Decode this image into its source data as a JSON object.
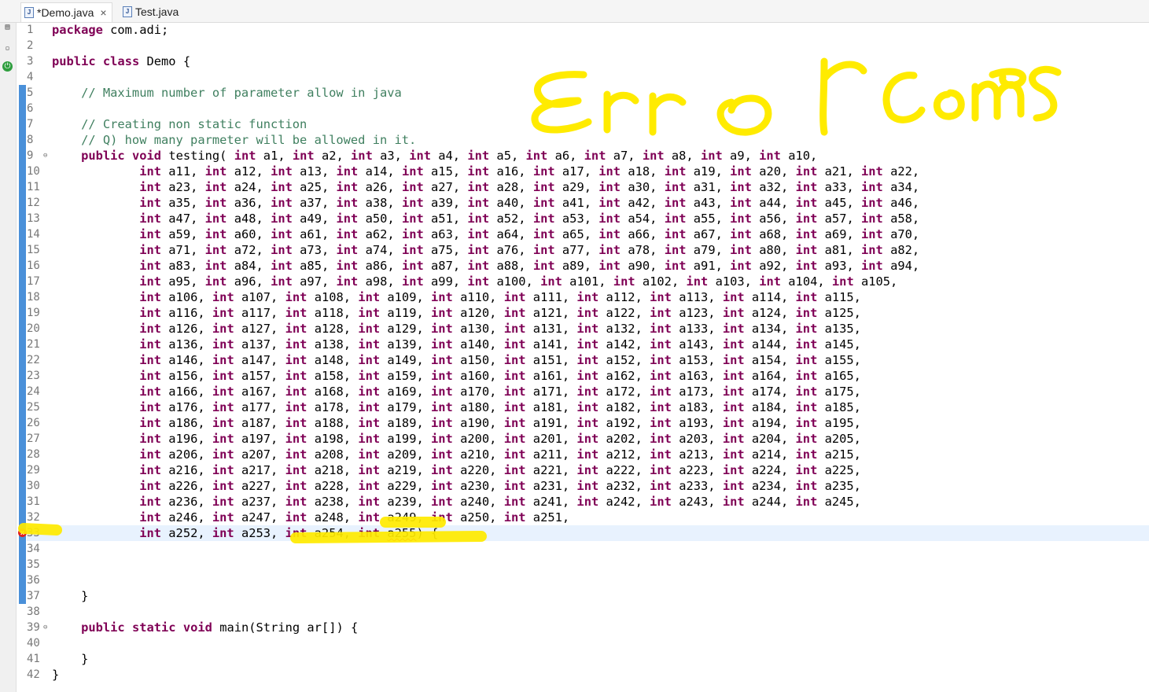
{
  "tabs": [
    {
      "label": "*Demo.java",
      "close": "×",
      "active": true
    },
    {
      "label": "Test.java",
      "active": false
    }
  ],
  "lines": [
    {
      "n": "1",
      "code": [
        {
          "t": "package",
          "c": "kw"
        },
        {
          "t": " com.adi;"
        }
      ]
    },
    {
      "n": "2",
      "code": []
    },
    {
      "n": "3",
      "code": [
        {
          "t": "public",
          "c": "kw"
        },
        {
          "t": " "
        },
        {
          "t": "class",
          "c": "kw"
        },
        {
          "t": " Demo {"
        }
      ]
    },
    {
      "n": "4",
      "code": []
    },
    {
      "n": "5",
      "code": [
        {
          "t": "    // Maximum number of parameter allow in java",
          "c": "cm"
        }
      ]
    },
    {
      "n": "6",
      "code": []
    },
    {
      "n": "7",
      "code": [
        {
          "t": "    // Creating non static function",
          "c": "cm"
        }
      ]
    },
    {
      "n": "8",
      "code": [
        {
          "t": "    // Q) how many parmeter will be allowed in it.",
          "c": "cm"
        }
      ]
    },
    {
      "n": "9",
      "fold": true,
      "code": [
        {
          "t": "    "
        },
        {
          "t": "public",
          "c": "kw"
        },
        {
          "t": " "
        },
        {
          "t": "void",
          "c": "kw"
        },
        {
          "t": " testing( "
        },
        {
          "t": "int",
          "c": "kw"
        },
        {
          "t": " a1, "
        },
        {
          "t": "int",
          "c": "kw"
        },
        {
          "t": " a2, "
        },
        {
          "t": "int",
          "c": "kw"
        },
        {
          "t": " a3, "
        },
        {
          "t": "int",
          "c": "kw"
        },
        {
          "t": " a4, "
        },
        {
          "t": "int",
          "c": "kw"
        },
        {
          "t": " a5, "
        },
        {
          "t": "int",
          "c": "kw"
        },
        {
          "t": " a6, "
        },
        {
          "t": "int",
          "c": "kw"
        },
        {
          "t": " a7, "
        },
        {
          "t": "int",
          "c": "kw"
        },
        {
          "t": " a8, "
        },
        {
          "t": "int",
          "c": "kw"
        },
        {
          "t": " a9, "
        },
        {
          "t": "int",
          "c": "kw"
        },
        {
          "t": " a10,"
        }
      ]
    },
    {
      "n": "10",
      "params": [
        11,
        22
      ]
    },
    {
      "n": "11",
      "params": [
        23,
        34
      ]
    },
    {
      "n": "12",
      "params": [
        35,
        46
      ]
    },
    {
      "n": "13",
      "params": [
        47,
        58
      ]
    },
    {
      "n": "14",
      "params": [
        59,
        70
      ]
    },
    {
      "n": "15",
      "params": [
        71,
        82
      ]
    },
    {
      "n": "16",
      "params": [
        83,
        94
      ]
    },
    {
      "n": "17",
      "params": [
        95,
        105
      ]
    },
    {
      "n": "18",
      "params": [
        106,
        115
      ]
    },
    {
      "n": "19",
      "params": [
        116,
        125
      ]
    },
    {
      "n": "20",
      "params": [
        126,
        135
      ]
    },
    {
      "n": "21",
      "params": [
        136,
        145
      ]
    },
    {
      "n": "22",
      "params": [
        146,
        155
      ]
    },
    {
      "n": "23",
      "params": [
        156,
        165
      ]
    },
    {
      "n": "24",
      "params": [
        166,
        175
      ]
    },
    {
      "n": "25",
      "params": [
        176,
        185
      ]
    },
    {
      "n": "26",
      "params": [
        186,
        195
      ]
    },
    {
      "n": "27",
      "params": [
        196,
        205
      ]
    },
    {
      "n": "28",
      "params": [
        206,
        215
      ]
    },
    {
      "n": "29",
      "params": [
        216,
        225
      ]
    },
    {
      "n": "30",
      "params": [
        226,
        235
      ]
    },
    {
      "n": "31",
      "params": [
        236,
        245
      ]
    },
    {
      "n": "32",
      "params": [
        246,
        251
      ]
    },
    {
      "n": "33",
      "error": true,
      "code": [
        {
          "t": "            "
        },
        {
          "t": "int",
          "c": "kw"
        },
        {
          "t": " a252, "
        },
        {
          "t": "int",
          "c": "kw"
        },
        {
          "t": " a253, "
        },
        {
          "t": "int",
          "c": "kw"
        },
        {
          "t": " a254, "
        },
        {
          "t": "int",
          "c": "kw"
        },
        {
          "t": " "
        },
        {
          "t": "a255",
          "c": "err"
        },
        {
          "t": ") {"
        }
      ]
    },
    {
      "n": "34",
      "code": []
    },
    {
      "n": "35",
      "code": []
    },
    {
      "n": "36",
      "code": []
    },
    {
      "n": "37",
      "code": [
        {
          "t": "    }"
        }
      ]
    },
    {
      "n": "38",
      "code": []
    },
    {
      "n": "39",
      "fold": true,
      "code": [
        {
          "t": "    "
        },
        {
          "t": "public",
          "c": "kw"
        },
        {
          "t": " "
        },
        {
          "t": "static",
          "c": "kw"
        },
        {
          "t": " "
        },
        {
          "t": "void",
          "c": "kw"
        },
        {
          "t": " main(String ar[]) {"
        }
      ]
    },
    {
      "n": "40",
      "code": []
    },
    {
      "n": "41",
      "code": [
        {
          "t": "    }"
        }
      ]
    },
    {
      "n": "42",
      "code": [
        {
          "t": "}"
        }
      ]
    }
  ],
  "annotation": {
    "text": "Error Comes",
    "color": "#ffeb00"
  },
  "colors": {
    "keyword": "#7f0055",
    "comment": "#3f7f5f",
    "change_bar": "#4a90d9",
    "current_line": "#e8f2fe"
  }
}
